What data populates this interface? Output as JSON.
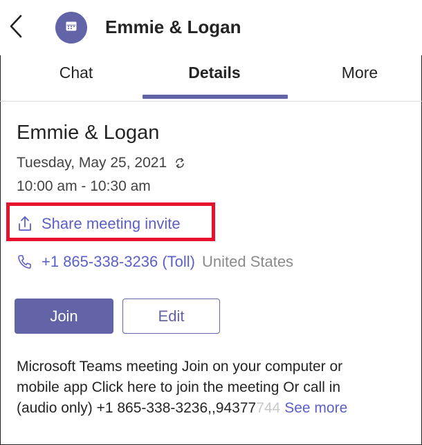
{
  "header": {
    "title": "Emmie & Logan",
    "back_icon": "chevron-left-icon",
    "avatar_icon": "calendar-icon",
    "accent_color": "#6264a7"
  },
  "tabs": [
    {
      "label": "Chat",
      "active": false
    },
    {
      "label": "Details",
      "active": true
    },
    {
      "label": "More",
      "active": false
    }
  ],
  "meeting": {
    "title": "Emmie & Logan",
    "date": "Tuesday, May 25, 2021",
    "recurring_icon": "recurring-icon",
    "time": "10:00 am - 10:30 am",
    "share_label": "Share meeting invite",
    "share_icon": "share-icon",
    "phone_icon": "phone-icon",
    "phone_number": "+1 865-338-3236 (Toll)",
    "phone_country": "United States"
  },
  "actions": {
    "join_label": "Join",
    "edit_label": "Edit"
  },
  "description": {
    "line1": "Microsoft Teams meeting Join on your computer or",
    "line2": "mobile app Click here to join the meeting Or call in",
    "line3_start": "(audio only) +1 865-338-3236,,94377",
    "line3_fade": "744",
    "see_more": "See more"
  },
  "highlight_color": "#e8112d"
}
